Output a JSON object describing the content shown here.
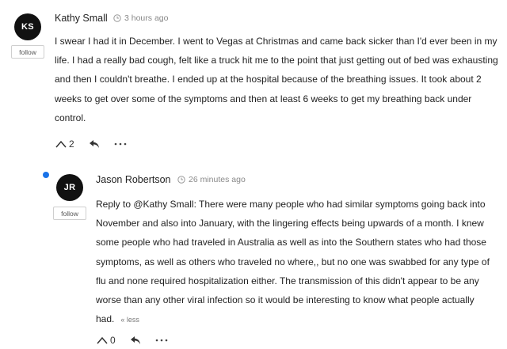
{
  "comments": [
    {
      "initials": "KS",
      "author": "Kathy Small",
      "time": "3 hours ago",
      "follow_label": "follow",
      "text": "I swear I had it in December. I went to Vegas at Christmas and came back sicker than I'd ever been in my life. I had a really bad cough, felt like a truck hit me to the point that just getting out of bed was exhausting and then I couldn't breathe. I ended up at the hospital because of the breathing issues. It took about 2 weeks to get over some of the symptoms and then at least 6 weeks to get my breathing back under control.",
      "votes": "2"
    },
    {
      "initials": "JR",
      "author": "Jason Robertson",
      "time": "26 minutes ago",
      "follow_label": "follow",
      "text": "Reply to @Kathy Small: There were many people who had similar symptoms going back into November and also into January, with the lingering effects being upwards of a month. I knew some people who had traveled in Australia as well as into the Southern states who had those symptoms, as well as others who traveled no where,, but no one was swabbed for any type of flu and none required hospitalization either. The transmission of this didn't appear to be any worse than any other viral infection so it would be interesting to know what people actually had.",
      "less_label": "« less",
      "votes": "0"
    }
  ],
  "icons": {
    "upvote": "chevron-up-icon",
    "reply": "reply-arrow-icon",
    "more": "more-dots-icon",
    "clock": "clock-icon"
  },
  "colors": {
    "unread_dot": "#1a73e8",
    "avatar_bg": "#111111"
  }
}
